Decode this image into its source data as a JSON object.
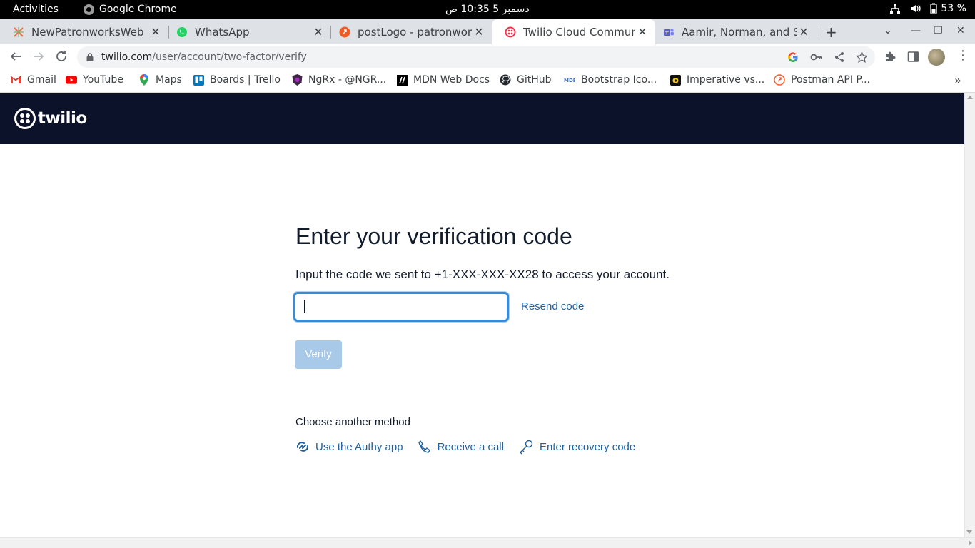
{
  "system_bar": {
    "activities": "Activities",
    "app_name": "Google Chrome",
    "clock": "دسمبر 5  10:35 ص",
    "battery": "53 %"
  },
  "tabs": [
    {
      "title": "NewPatronworksWeb",
      "icon": "figma-like-icon",
      "active": false
    },
    {
      "title": "WhatsApp",
      "icon": "whatsapp-icon",
      "active": false
    },
    {
      "title": "postLogo - patronworks",
      "icon": "postman-icon",
      "active": false
    },
    {
      "title": "Twilio Cloud Communica",
      "icon": "twilio-icon",
      "active": true
    },
    {
      "title": "Aamir, Norman, and Sau",
      "icon": "teams-icon",
      "active": false
    }
  ],
  "toolbar": {
    "url_host": "twilio.com",
    "url_path": "/user/account/two-factor/verify"
  },
  "bookmarks": [
    {
      "label": "Gmail",
      "icon": "gmail-icon"
    },
    {
      "label": "YouTube",
      "icon": "youtube-icon"
    },
    {
      "label": "Maps",
      "icon": "maps-icon"
    },
    {
      "label": "Boards | Trello",
      "icon": "trello-icon"
    },
    {
      "label": "NgRx - @NGR...",
      "icon": "ngrx-icon"
    },
    {
      "label": "MDN Web Docs",
      "icon": "mdn-icon"
    },
    {
      "label": "GitHub",
      "icon": "github-icon"
    },
    {
      "label": "Bootstrap Ico...",
      "icon": "mdb-icon"
    },
    {
      "label": "Imperative vs...",
      "icon": "imperative-icon"
    },
    {
      "label": "Postman API P...",
      "icon": "postman-icon"
    }
  ],
  "page": {
    "brand": "twilio",
    "heading": "Enter your verification code",
    "lead": "Input the code we sent to +1-XXX-XXX-XX28 to access your account.",
    "code_value": "",
    "resend": "Resend code",
    "verify": "Verify",
    "choose_label": "Choose another method",
    "methods": [
      {
        "label": "Use the Authy app",
        "icon": "authy-icon"
      },
      {
        "label": "Receive a call",
        "icon": "phone-icon"
      },
      {
        "label": "Enter recovery code",
        "icon": "key-icon"
      }
    ]
  },
  "colors": {
    "header_bg": "#0d122b",
    "link": "#1f5f9d",
    "input_focus": "#3a8bd6",
    "verify_disabled": "#a8c9e8"
  }
}
